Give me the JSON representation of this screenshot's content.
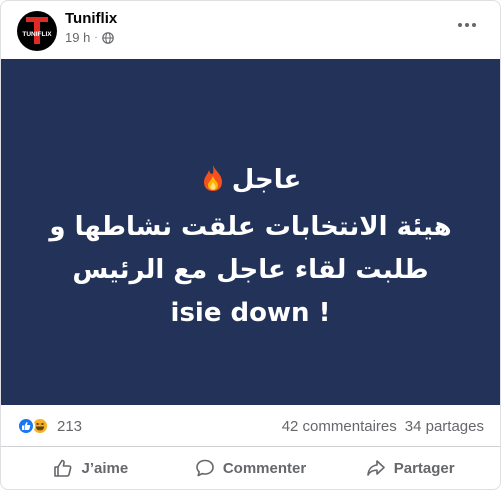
{
  "header": {
    "page_name": "Tuniflix",
    "time": "19 h",
    "separator": "·",
    "avatar_text": "TUNIFLIX",
    "privacy_icon": "globe-icon",
    "more_icon": "more-options-icon"
  },
  "post": {
    "background_color": "#223259",
    "lines": [
      "عاجل",
      "هيئة الانتخابات علقت نشاطها و",
      "طلبت لقاء عاجل مع الرئيس",
      "isie down !"
    ],
    "emoji_icon": "fire-icon"
  },
  "stats": {
    "reaction_icons": [
      "like-reaction-icon",
      "haha-reaction-icon"
    ],
    "reaction_count": "213",
    "comments": "42 commentaires",
    "shares": "34 partages"
  },
  "actions": {
    "like": "J’aime",
    "comment": "Commenter",
    "share": "Partager"
  },
  "colors": {
    "brand_blue": "#1877f2",
    "secondary_text": "#65676b",
    "avatar_red": "#e02a26"
  }
}
